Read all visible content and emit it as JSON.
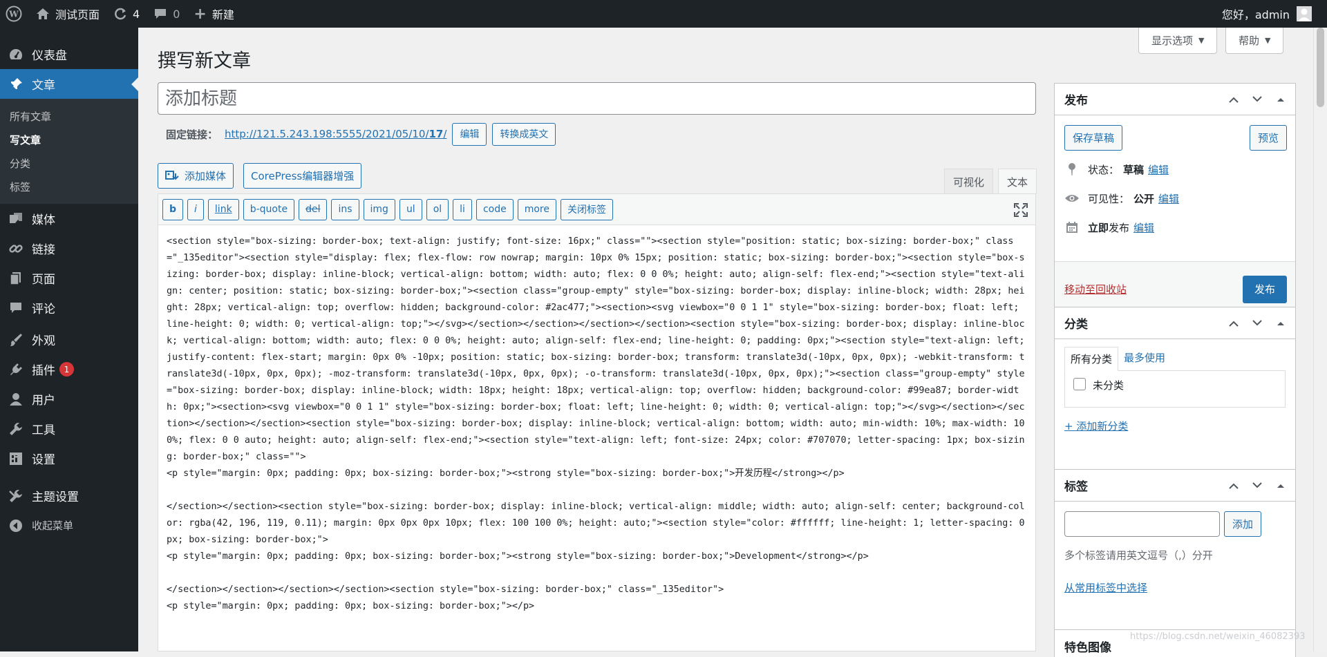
{
  "adminbar": {
    "site_name": "测试页面",
    "updates_count": "4",
    "comments_count": "0",
    "new_label": "新建",
    "greeting": "您好，admin"
  },
  "sidebar": {
    "items": [
      {
        "label": "仪表盘",
        "icon": "dashboard-icon"
      },
      {
        "label": "文章",
        "icon": "pin-icon"
      },
      {
        "label": "媒体",
        "icon": "media-icon"
      },
      {
        "label": "链接",
        "icon": "link-icon"
      },
      {
        "label": "页面",
        "icon": "page-icon"
      },
      {
        "label": "评论",
        "icon": "comment-icon"
      },
      {
        "label": "外观",
        "icon": "appearance-icon"
      },
      {
        "label": "插件",
        "icon": "plugin-icon",
        "badge": "1"
      },
      {
        "label": "用户",
        "icon": "user-icon"
      },
      {
        "label": "工具",
        "icon": "wrench-icon"
      },
      {
        "label": "设置",
        "icon": "settings-icon"
      },
      {
        "label": "主题设置",
        "icon": "theme-settings-icon"
      },
      {
        "label": "收起菜单",
        "icon": "collapse-icon"
      }
    ],
    "submenu": [
      "所有文章",
      "写文章",
      "分类",
      "标签"
    ]
  },
  "header": {
    "screen_options": "显示选项",
    "help": "帮助",
    "page_title": "撰写新文章"
  },
  "editor": {
    "title_placeholder": "添加标题",
    "permalink_label": "固定链接：",
    "permalink_url_prefix": "http://121.5.243.198:5555/2021/05/10/",
    "permalink_url_slug": "17",
    "permalink_url_suffix": "/",
    "edit_button": "编辑",
    "convert_button": "转换成英文",
    "add_media": "添加媒体",
    "corepress_button": "CorePress编辑器增强",
    "tab_visual": "可视化",
    "tab_text": "文本",
    "quicktags": [
      "b",
      "i",
      "link",
      "b-quote",
      "del",
      "ins",
      "img",
      "ul",
      "ol",
      "li",
      "code",
      "more",
      "关闭标签"
    ],
    "content": "<section style=\"box-sizing: border-box; text-align: justify; font-size: 16px;\" class=\"\"><section style=\"position: static; box-sizing: border-box;\" class=\"_135editor\"><section style=\"display: flex; flex-flow: row nowrap; margin: 10px 0% 15px; position: static; box-sizing: border-box;\"><section style=\"box-sizing: border-box; display: inline-block; vertical-align: bottom; width: auto; flex: 0 0 0%; height: auto; align-self: flex-end;\"><section style=\"text-align: center; position: static; box-sizing: border-box;\"><section class=\"group-empty\" style=\"box-sizing: border-box; display: inline-block; width: 28px; height: 28px; vertical-align: top; overflow: hidden; background-color: #2ac477;\"><section><svg viewbox=\"0 0 1 1\" style=\"box-sizing: border-box; float: left; line-height: 0; width: 0; vertical-align: top;\"></svg></section></section></section></section><section style=\"box-sizing: border-box; display: inline-block; vertical-align: bottom; width: auto; flex: 0 0 0%; height: auto; align-self: flex-end; line-height: 0; padding: 0px;\"><section style=\"text-align: left; justify-content: flex-start; margin: 0px 0% -10px; position: static; box-sizing: border-box; transform: translate3d(-10px, 0px, 0px); -webkit-transform: translate3d(-10px, 0px, 0px); -moz-transform: translate3d(-10px, 0px, 0px); -o-transform: translate3d(-10px, 0px, 0px);\"><section class=\"group-empty\" style=\"box-sizing: border-box; display: inline-block; width: 18px; height: 18px; vertical-align: top; overflow: hidden; background-color: #99ea87; border-width: 0px;\"><section><svg viewbox=\"0 0 1 1\" style=\"box-sizing: border-box; float: left; line-height: 0; width: 0; vertical-align: top;\"></svg></section></section></section></section><section style=\"box-sizing: border-box; display: inline-block; vertical-align: bottom; width: auto; min-width: 10%; max-width: 100%; flex: 0 0 auto; height: auto; align-self: flex-end;\"><section style=\"text-align: left; font-size: 24px; color: #707070; letter-spacing: 1px; box-sizing: border-box;\" class=\"\">\n<p style=\"margin: 0px; padding: 0px; box-sizing: border-box;\"><strong style=\"box-sizing: border-box;\">开发历程</strong></p>\n\n</section></section><section style=\"box-sizing: border-box; display: inline-block; vertical-align: middle; width: auto; align-self: center; background-color: rgba(42, 196, 119, 0.11); margin: 0px 0px 0px 10px; flex: 100 100 0%; height: auto;\"><section style=\"color: #ffffff; line-height: 1; letter-spacing: 0px; box-sizing: border-box;\">\n<p style=\"margin: 0px; padding: 0px; box-sizing: border-box;\"><strong style=\"box-sizing: border-box;\">Development</strong></p>\n\n</section></section></section></section><section style=\"box-sizing: border-box;\" class=\"_135editor\">\n<p style=\"margin: 0px; padding: 0px; box-sizing: border-box;\"></p>"
  },
  "publish": {
    "title": "发布",
    "save_draft": "保存草稿",
    "preview": "预览",
    "status_label": "状态：",
    "status_value": "草稿",
    "status_edit": "编辑",
    "visibility_label": "可见性：",
    "visibility_value": "公开",
    "visibility_edit": "编辑",
    "schedule_bold": "立即",
    "schedule_text": "发布",
    "schedule_edit": "编辑",
    "trash": "移动至回收站",
    "publish_button": "发布"
  },
  "categories": {
    "title": "分类",
    "tab_all": "所有分类",
    "tab_popular": "最多使用",
    "items": [
      "未分类"
    ],
    "add_new": "+ 添加新分类"
  },
  "tags": {
    "title": "标签",
    "add_button": "添加",
    "hint": "多个标签请用英文逗号（,）分开",
    "choose_link": "从常用标签中选择"
  },
  "featured_image": {
    "title": "特色图像"
  },
  "watermark": "https://blog.csdn.net/weixin_46082393"
}
